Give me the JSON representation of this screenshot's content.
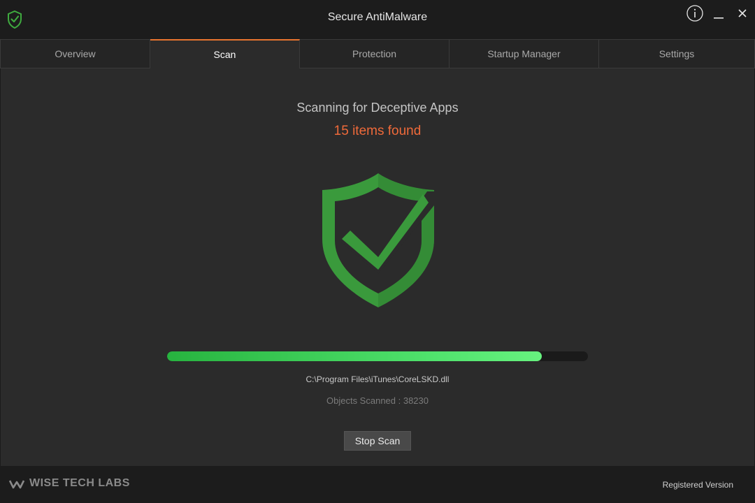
{
  "window": {
    "title": "Secure AntiMalware",
    "app_icon": "shield-check-icon",
    "controls": {
      "info_icon": "info-icon",
      "minimize_icon": "minimize-icon",
      "close_icon": "close-icon"
    }
  },
  "tabs": [
    {
      "label": "Overview",
      "active": false
    },
    {
      "label": "Scan",
      "active": true
    },
    {
      "label": "Protection",
      "active": false
    },
    {
      "label": "Startup Manager",
      "active": false
    },
    {
      "label": "Settings",
      "active": false
    }
  ],
  "scan": {
    "title": "Scanning for Deceptive Apps",
    "items_found": "15 items found",
    "shield_icon": "shield-check-icon",
    "progress_fraction": 0.89,
    "current_file": "C:\\Program Files\\iTunes\\CoreLSKD.dll",
    "objects_scanned": "Objects Scanned : 38230",
    "stop_button": "Stop Scan"
  },
  "footer": {
    "brand": "WISE TECH LABS",
    "brand_icon": "wise-tech-labs-logo",
    "license": "Registered Version"
  },
  "colors": {
    "accent": "#e8742f",
    "found": "#ef6a3a",
    "shield_green": "#3a9a3c",
    "progress_green": "#4fe26c"
  }
}
